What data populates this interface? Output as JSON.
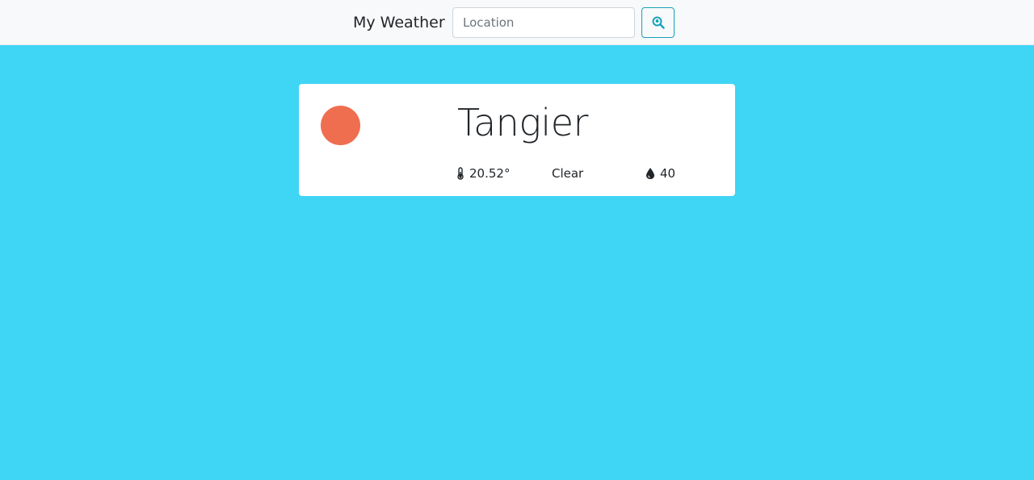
{
  "navbar": {
    "brand": "My Weather",
    "search": {
      "placeholder": "Location",
      "value": ""
    },
    "search_button_icon": "search-location-icon"
  },
  "weather": {
    "city": "Tangier",
    "temperature": "20.52°",
    "condition": "Clear",
    "humidity": "40",
    "sun_color": "#ee6e4f",
    "temperature_icon": "thermometer-icon",
    "humidity_icon": "droplet-icon"
  },
  "colors": {
    "background": "#3fd5f4",
    "navbar": "#f8f9fa",
    "accent": "#17a2b8",
    "card": "#ffffff"
  }
}
